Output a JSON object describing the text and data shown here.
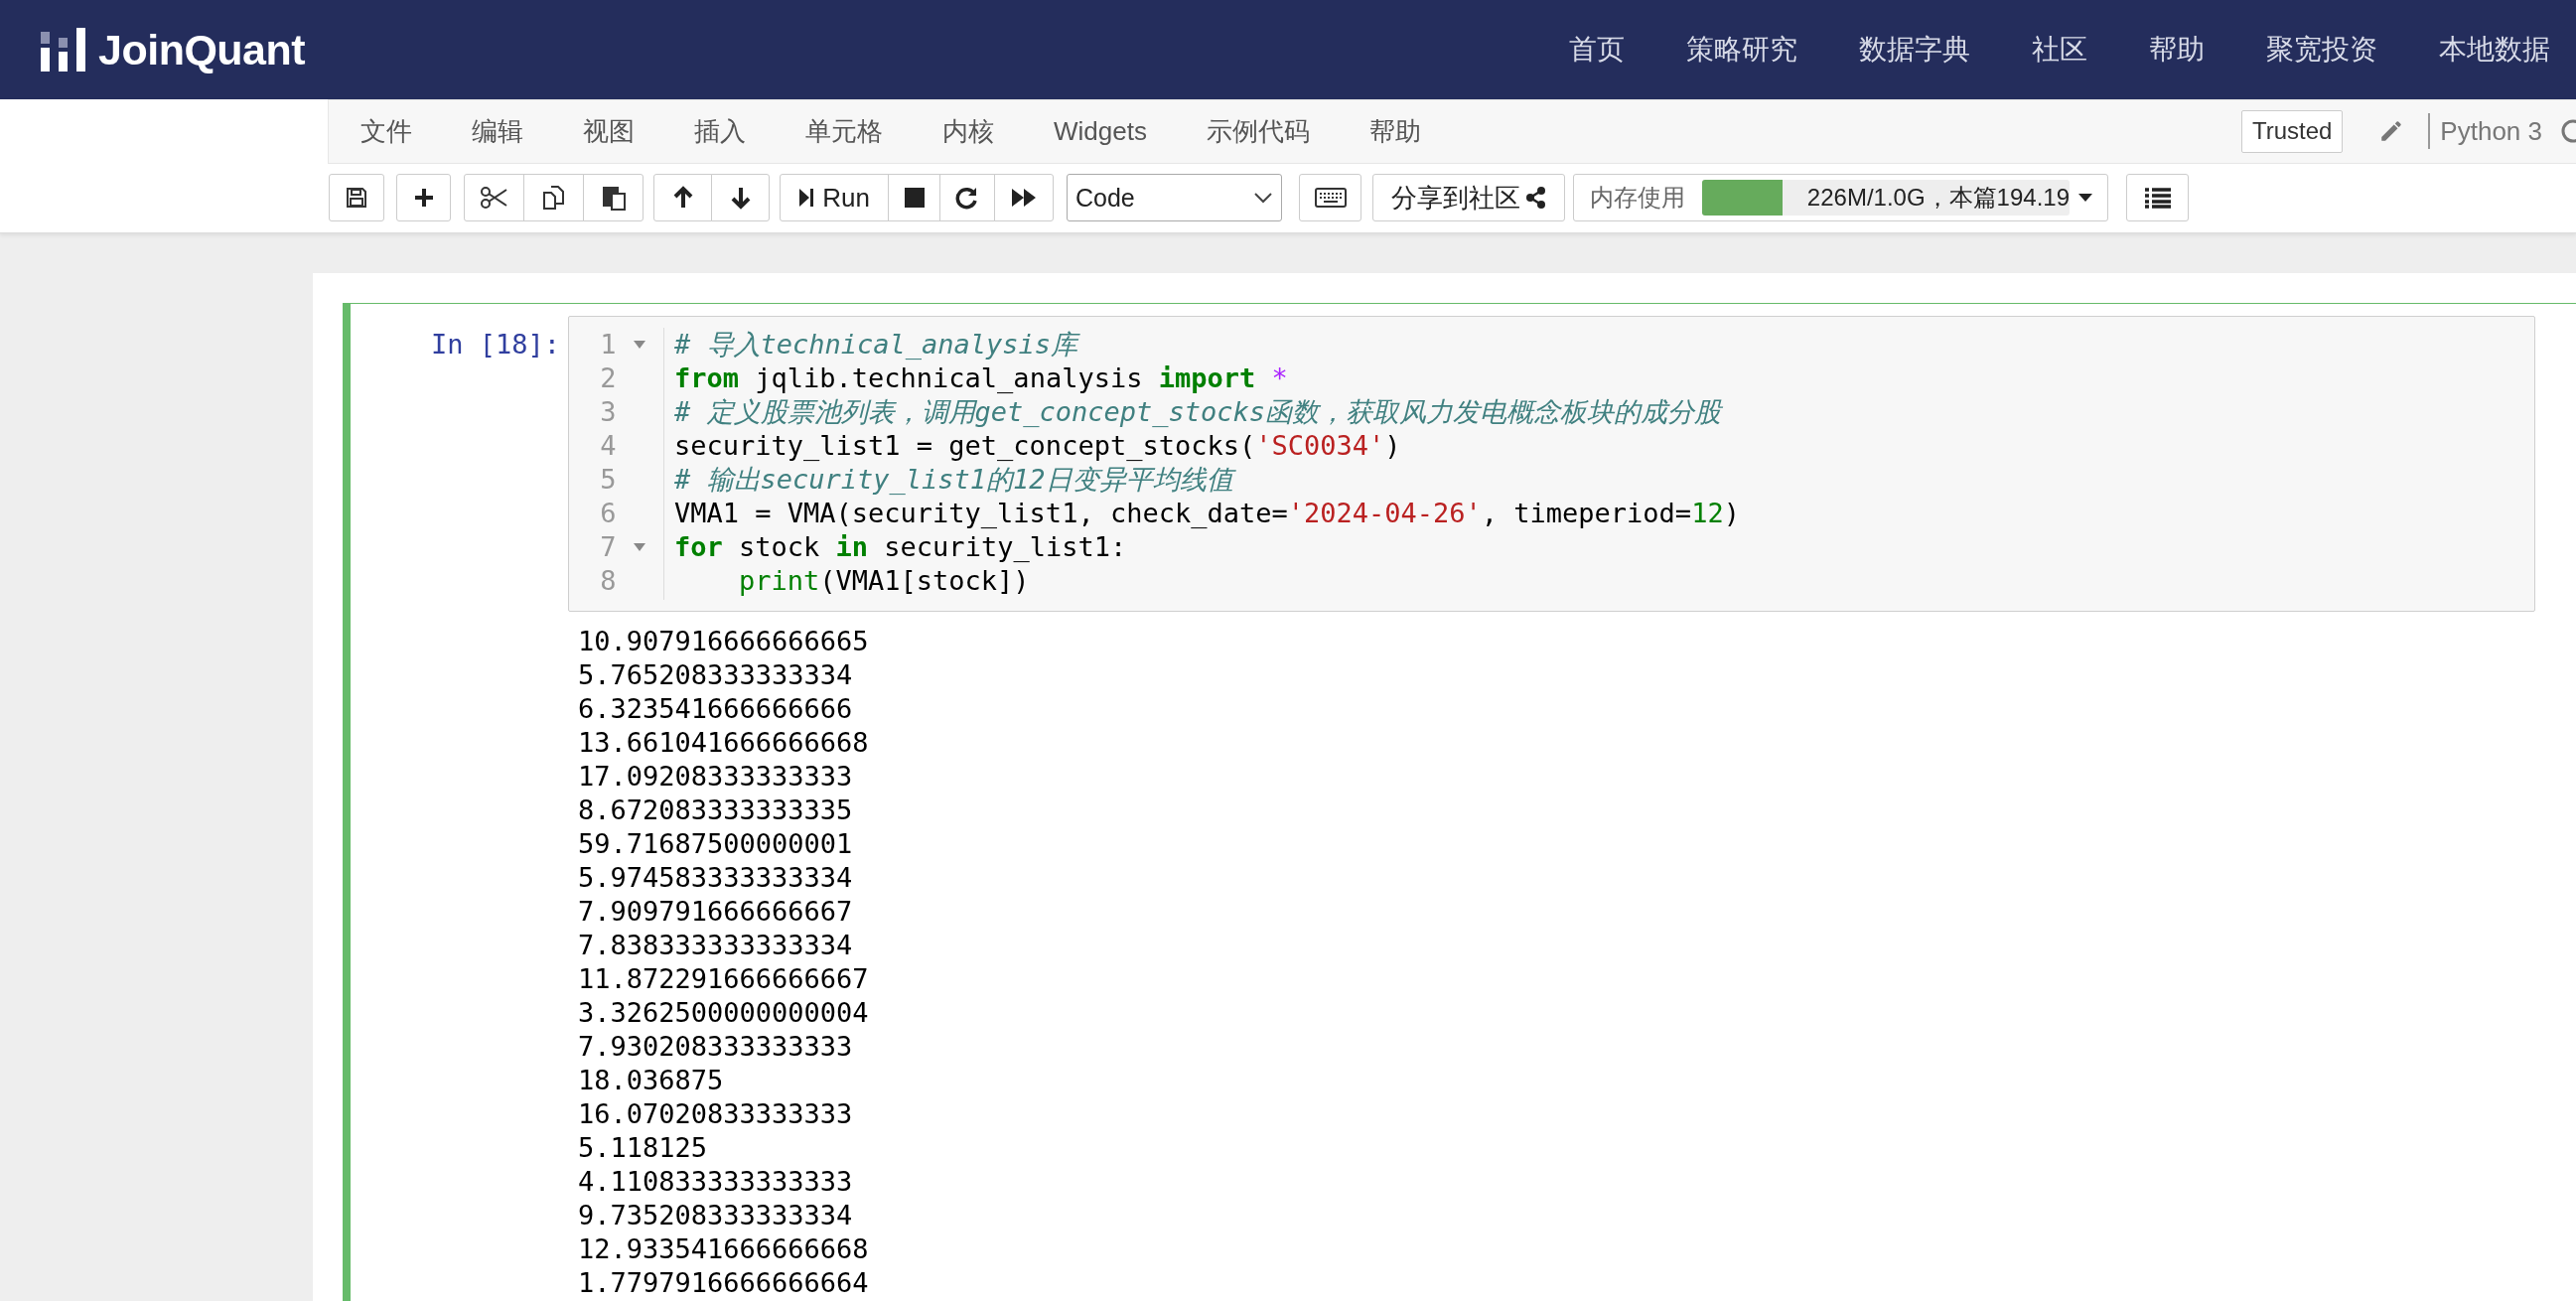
{
  "header": {
    "logo": "JoinQuant",
    "nav": [
      "首页",
      "策略研究",
      "数据字典",
      "社区",
      "帮助",
      "聚宽投资",
      "本地数据"
    ]
  },
  "menu": {
    "items": [
      "文件",
      "编辑",
      "视图",
      "插入",
      "单元格",
      "内核",
      "Widgets",
      "示例代码",
      "帮助"
    ],
    "trusted": "Trusted",
    "kernel": "Python 3"
  },
  "toolbar": {
    "run_label": "Run",
    "cell_type": "Code",
    "share_label": "分享到社区",
    "memory": {
      "label": "内存使用",
      "level": 0.22,
      "reading": "226M/1.0G，本篇194.19"
    }
  },
  "cell": {
    "prompt": "In [18]:",
    "selected": true,
    "lines": [
      {
        "number": "1",
        "foldable": true,
        "tokens": [
          {
            "kind": "comment",
            "text": "# 导入technical_analysis库"
          }
        ]
      },
      {
        "number": "2",
        "foldable": false,
        "tokens": [
          {
            "kind": "keyword",
            "text": "from"
          },
          {
            "kind": "plain",
            "text": " jqlib.technical_analysis "
          },
          {
            "kind": "keyword",
            "text": "import"
          },
          {
            "kind": "operator",
            "text": " *"
          }
        ]
      },
      {
        "number": "3",
        "foldable": false,
        "tokens": [
          {
            "kind": "comment",
            "text": "# 定义股票池列表，调用get_concept_stocks函数，获取风力发电概念板块的成分股"
          }
        ]
      },
      {
        "number": "4",
        "foldable": false,
        "tokens": [
          {
            "kind": "plain",
            "text": "security_list1 = get_concept_stocks("
          },
          {
            "kind": "string",
            "text": "'SC0034'"
          },
          {
            "kind": "plain",
            "text": ")"
          }
        ]
      },
      {
        "number": "5",
        "foldable": false,
        "tokens": [
          {
            "kind": "comment",
            "text": "# 输出security_list1的12日变异平均线值"
          }
        ]
      },
      {
        "number": "6",
        "foldable": false,
        "tokens": [
          {
            "kind": "plain",
            "text": "VMA1 = VMA(security_list1, check_date="
          },
          {
            "kind": "string",
            "text": "'2024-04-26'"
          },
          {
            "kind": "plain",
            "text": ", timeperiod="
          },
          {
            "kind": "number",
            "text": "12"
          },
          {
            "kind": "plain",
            "text": ")"
          }
        ]
      },
      {
        "number": "7",
        "foldable": true,
        "tokens": [
          {
            "kind": "keyword",
            "text": "for"
          },
          {
            "kind": "plain",
            "text": " stock "
          },
          {
            "kind": "keyword",
            "text": "in"
          },
          {
            "kind": "plain",
            "text": " security_list1:"
          }
        ]
      },
      {
        "number": "8",
        "foldable": false,
        "indented": true,
        "tokens": [
          {
            "kind": "builtin",
            "text": "print"
          },
          {
            "kind": "plain",
            "text": "(VMA1[stock])"
          }
        ]
      }
    ],
    "output": [
      "10.907916666666665",
      "5.765208333333334",
      "6.323541666666666",
      "13.661041666666668",
      "17.09208333333333",
      "8.672083333333335",
      "59.71687500000001",
      "5.974583333333334",
      "7.909791666666667",
      "7.838333333333334",
      "11.872291666666667",
      "3.3262500000000004",
      "7.930208333333333",
      "18.036875",
      "16.07020833333333",
      "5.118125",
      "4.110833333333333",
      "9.735208333333334",
      "12.933541666666668",
      "1.7797916666666664"
    ]
  }
}
